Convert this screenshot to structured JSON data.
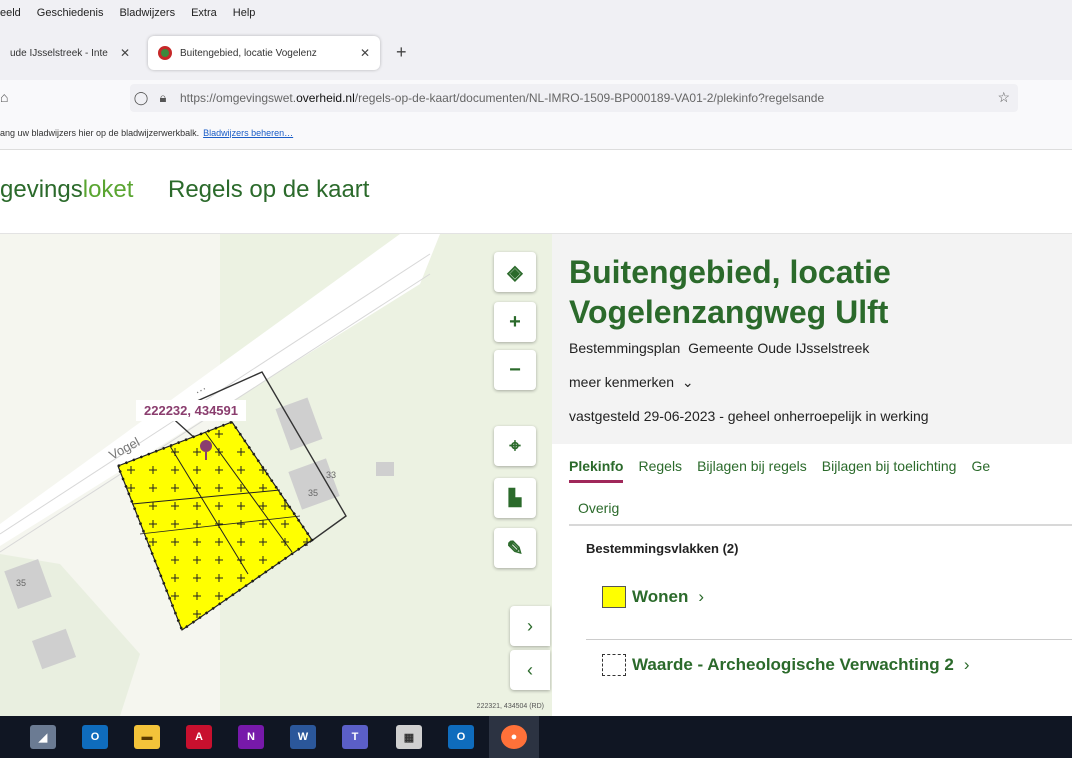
{
  "browser": {
    "menu": [
      "eeld",
      "Geschiedenis",
      "Bladwijzers",
      "Extra",
      "Help"
    ],
    "tabs": [
      {
        "label": "ude IJsselstreek - Inte",
        "close": "✕"
      },
      {
        "label": "Buitengebied, locatie Vogelenz",
        "close": "✕"
      }
    ],
    "new_tab": "+",
    "url_prefix": "https://omgevingswet.",
    "url_domain": "overheid.nl",
    "url_rest": "/regels-op-de-kaart/documenten/NL-IMRO-1509-BP000189-VA01-2/plekinfo?regelsande",
    "bookmarks_text": "ang uw bladwijzers hier op de bladwijzerwerkbalk.",
    "bookmarks_link": "Bladwijzers beheren…"
  },
  "header": {
    "brand_dark": "gevings",
    "brand_light": "loket",
    "title": "Regels op de kaart"
  },
  "map": {
    "coordinate": "222232, 434591",
    "footer_coords": "222321, 434504 (RD)",
    "street_label": "Vogel",
    "house_numbers": [
      "35",
      "33",
      "35"
    ],
    "controls": [
      "layers-icon",
      "zoom-in-icon",
      "zoom-out-icon",
      "locate-icon",
      "measure-icon",
      "draw-icon"
    ],
    "zoom_in": "+",
    "zoom_out": "−",
    "chevron_right": "›",
    "chevron_left": "‹"
  },
  "panel": {
    "title": "Buitengebied, locatie Vogelenzangweg Ulft",
    "type": "Bestemmingsplan",
    "authority": "Gemeente Oude IJsselstreek",
    "more": "meer kenmerken",
    "status": "vastgesteld 29-06-2023 - geheel onherroepelijk in werking",
    "tabs": [
      "Plekinfo",
      "Regels",
      "Bijlagen bij regels",
      "Bijlagen bij toelichting",
      "Ge"
    ],
    "tab_overflow": "Overig",
    "section": "Bestemmingsvlakken (2)",
    "items": [
      {
        "label": "Wonen",
        "color": "#ffff00"
      },
      {
        "label": "Waarde - Archeologische Verwachting 2",
        "color": "#ffffff"
      }
    ]
  },
  "colors": {
    "primary_green": "#2b6a2b",
    "light_green": "#5aa531",
    "accent": "#a0285a",
    "plot_yellow": "#ffff00"
  },
  "taskbar": {
    "icons": [
      "settings-icon",
      "outlook-icon",
      "file-explorer-icon",
      "acrobat-icon",
      "onenote-icon",
      "word-icon",
      "teams-icon",
      "calculator-icon",
      "outlook-alt-icon",
      "firefox-icon"
    ]
  }
}
